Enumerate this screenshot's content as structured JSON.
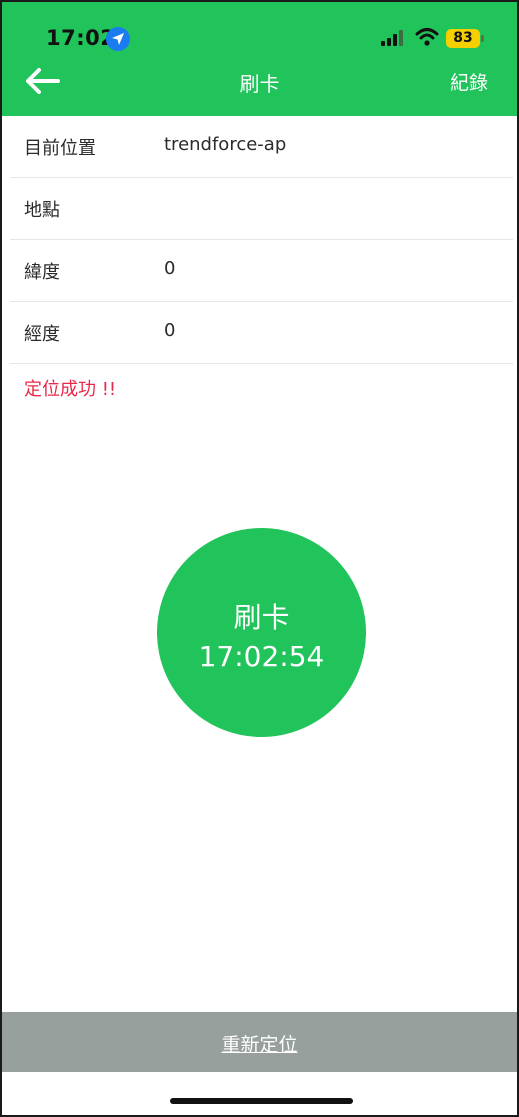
{
  "status_bar": {
    "time": "17:02",
    "battery": "83",
    "icons": [
      "location-arrow-icon",
      "cellular-signal-icon",
      "wifi-icon",
      "battery-icon"
    ]
  },
  "nav": {
    "back_icon": "arrow-left-icon",
    "title": "刷卡",
    "records_label": "紀錄"
  },
  "info": {
    "rows": [
      {
        "label": "目前位置",
        "value": "trendforce-ap"
      },
      {
        "label": "地點",
        "value": ""
      },
      {
        "label": "緯度",
        "value": "0"
      },
      {
        "label": "經度",
        "value": "0"
      }
    ],
    "status_message": "定位成功 !!"
  },
  "punch_button": {
    "label": "刷卡",
    "time": "17:02:54"
  },
  "footer": {
    "relocate_label": "重新定位"
  },
  "colors": {
    "brand_green": "#21c35b",
    "error_red": "#e8294a",
    "footer_gray": "#98a09e",
    "battery_yellow": "#f5d000",
    "location_blue": "#1a7cf0"
  }
}
